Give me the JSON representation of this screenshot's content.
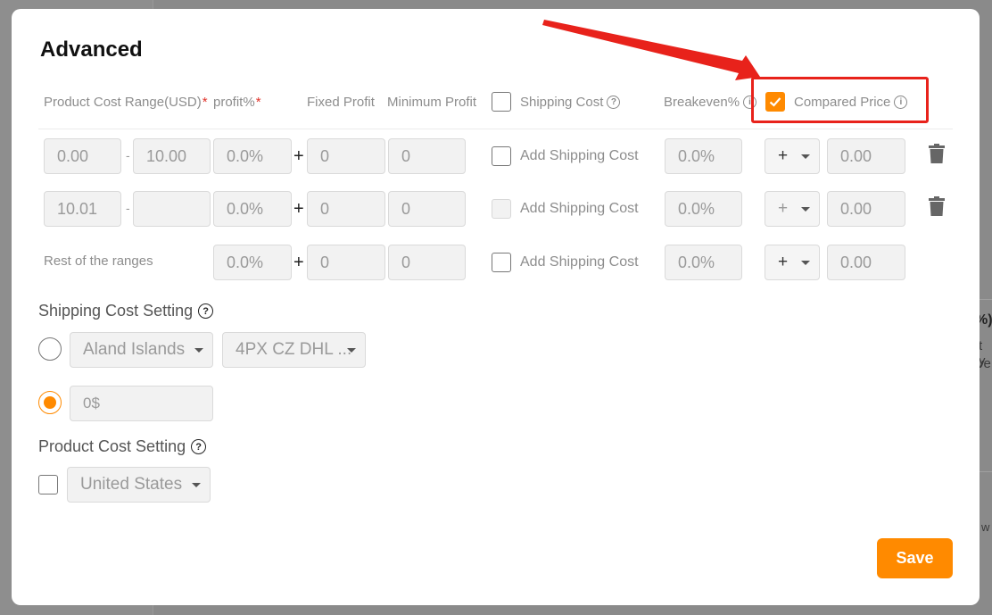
{
  "background": {
    "fragments": [
      "%)",
      "t y",
      "ve",
      "w"
    ]
  },
  "dialog": {
    "title": "Advanced",
    "headers": {
      "product_cost_range": "Product Cost Range(USD)",
      "required_mark": "*",
      "profit_pct": "profit%",
      "fixed_profit": "Fixed Profit",
      "minimum_profit": "Minimum Profit",
      "shipping_cost": "Shipping Cost",
      "breakeven": "Breakeven%",
      "compared_price": "Compared Price",
      "info_glyph": "?",
      "info_glyph_small": "i"
    },
    "shipping_cost_header_checked": false,
    "compared_price_checked": true,
    "rows": [
      {
        "from": "0.00",
        "to": "10.00",
        "profit": "0.0%",
        "fixed": "0",
        "minimum": "0",
        "add_shipping_label": "Add Shipping Cost",
        "add_shipping_checked": false,
        "add_shipping_disabled": false,
        "breakeven": "0.0%",
        "op": "+",
        "compared": "0.00"
      },
      {
        "from": "10.01",
        "to": "",
        "profit": "0.0%",
        "fixed": "0",
        "minimum": "0",
        "add_shipping_label": "Add Shipping Cost",
        "add_shipping_checked": false,
        "add_shipping_disabled": true,
        "breakeven": "0.0%",
        "op": "+",
        "compared": "0.00"
      },
      {
        "label": "Rest of the ranges",
        "profit": "0.0%",
        "fixed": "0",
        "minimum": "0",
        "add_shipping_label": "Add Shipping Cost",
        "add_shipping_checked": false,
        "add_shipping_disabled": false,
        "breakeven": "0.0%",
        "op": "+",
        "compared": "0.00"
      }
    ],
    "range_dash": "-",
    "plus_sign": "+",
    "shipping_cost_setting": {
      "title": "Shipping Cost Setting",
      "country_select": "Aland Islands",
      "method_select": "4PX CZ DHL ...",
      "fixed_value": "0$",
      "selected_option": "fixed"
    },
    "product_cost_setting": {
      "title": "Product Cost Setting",
      "checked": false,
      "country_select": "United States"
    },
    "save_label": "Save"
  },
  "colors": {
    "accent": "#ff8a00",
    "annotation": "#e8221b",
    "required": "#e0342b"
  },
  "icons": [
    "question-icon",
    "info-icon",
    "check-icon",
    "caret-down-icon",
    "trash-icon",
    "annotation-arrow"
  ]
}
